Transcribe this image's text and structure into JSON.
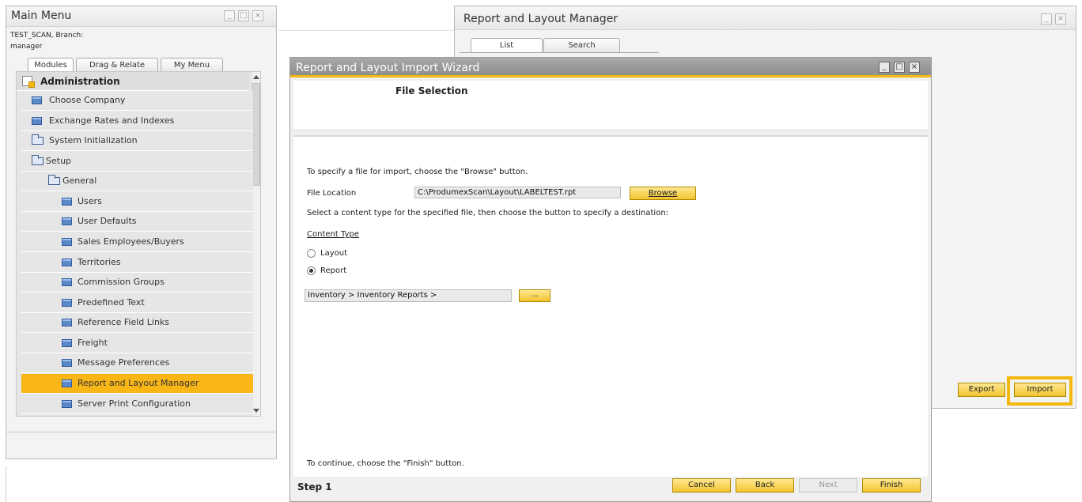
{
  "main_menu": {
    "title": "Main Menu",
    "company_line": "TEST_SCAN, Branch:",
    "user_line": "manager",
    "tabs": [
      "Modules",
      "Drag & Relate",
      "My Menu"
    ],
    "section": "Administration",
    "items": [
      {
        "label": "Choose Company"
      },
      {
        "label": "Exchange Rates and Indexes"
      },
      {
        "label": "System Initialization"
      },
      {
        "label": "Setup"
      },
      {
        "label": "General"
      },
      {
        "label": "Users"
      },
      {
        "label": "User Defaults"
      },
      {
        "label": "Sales Employees/Buyers"
      },
      {
        "label": "Territories"
      },
      {
        "label": "Commission Groups"
      },
      {
        "label": "Predefined Text"
      },
      {
        "label": "Reference Field Links"
      },
      {
        "label": "Freight"
      },
      {
        "label": "Message Preferences"
      },
      {
        "label": "Report and Layout Manager"
      },
      {
        "label": "Server Print Configuration"
      }
    ],
    "selected_item": "Report and Layout Manager",
    "highlight_color": "#f8b617"
  },
  "report_manager": {
    "title": "Report and Layout Manager",
    "tabs": [
      "List",
      "Search"
    ],
    "buttons": {
      "export": "Export",
      "import": "Import"
    },
    "focus_color": "#f5b80f"
  },
  "wizard": {
    "title": "Report and Layout Import Wizard",
    "heading": "File Selection",
    "instruction": "To specify a file for import, choose the \"Browse\" button.",
    "file_location_label": "File Location",
    "file_location_value": "C:\\ProdumexScan\\Layout\\LABELTEST.rpt",
    "browse_button": "Browse",
    "select_instruction": "Select a content type for the specified file, then choose the button to specify a destination:",
    "content_type_label": "Content Type",
    "options": [
      "Layout",
      "Report"
    ],
    "selected_option": "Report",
    "destination_value": "Inventory > Inventory Reports >",
    "ellipsis_button": "...",
    "continue_text": "To continue, choose the \"Finish\" button.",
    "step_label": "Step 1",
    "buttons": {
      "cancel": "Cancel",
      "back": "Back",
      "next": "Next",
      "finish": "Finish"
    }
  }
}
